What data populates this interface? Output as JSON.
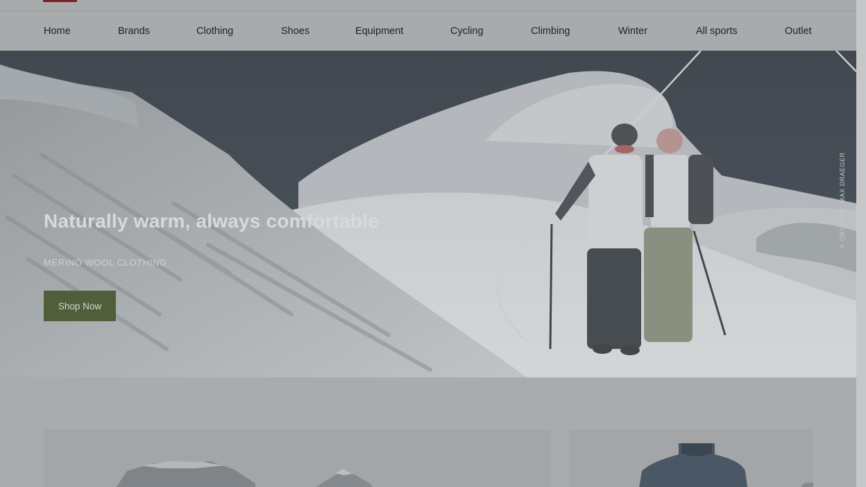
{
  "nav": {
    "items": [
      {
        "label": "Home"
      },
      {
        "label": "Brands"
      },
      {
        "label": "Clothing"
      },
      {
        "label": "Shoes"
      },
      {
        "label": "Equipment"
      },
      {
        "label": "Cycling"
      },
      {
        "label": "Climbing"
      },
      {
        "label": "Winter"
      },
      {
        "label": "All sports"
      },
      {
        "label": "Outlet"
      }
    ]
  },
  "hero": {
    "title": "Naturally warm, always comfortable",
    "subtitle": "MERINO WOOL CLOTHING",
    "cta_label": "Shop Now",
    "photo_credit": "© ORTOVOX, MAX DRAEGER"
  },
  "colors": {
    "accent_green": "#4e5f3a",
    "logo_red": "#7a2226",
    "overlay_gray": "#a9abad"
  },
  "icons": [
    "logo"
  ]
}
